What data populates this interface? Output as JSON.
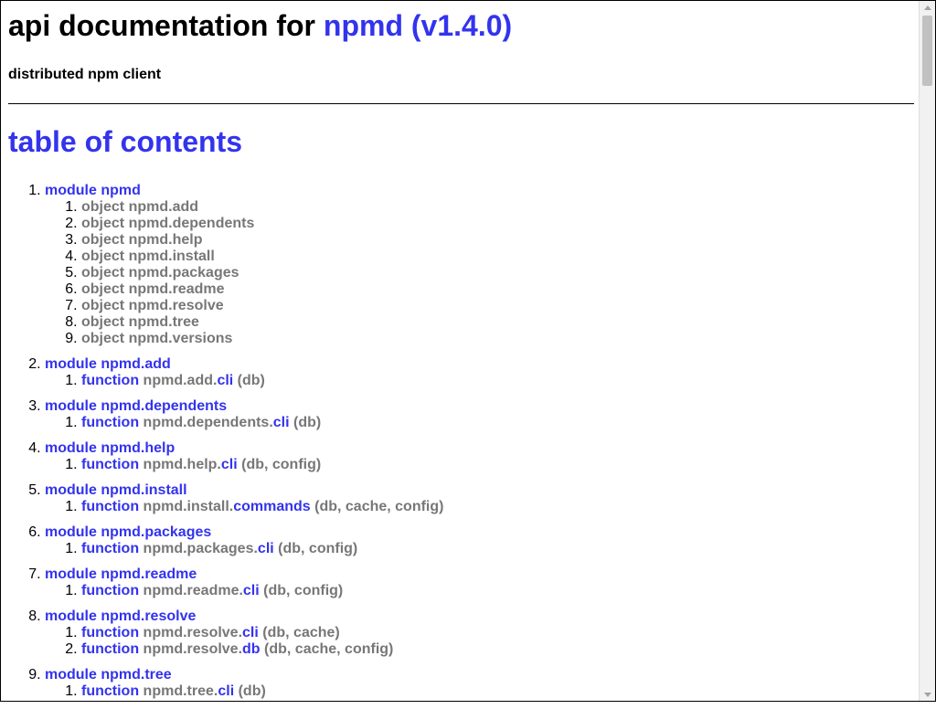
{
  "header": {
    "prefix": "api documentation for ",
    "link": "npmd (v1.4.0)",
    "subtitle": "distributed npm client"
  },
  "toc": {
    "title": "table of contents",
    "modules": [
      {
        "label": "module npmd",
        "items": [
          {
            "kind": "object",
            "name": "npmd.add"
          },
          {
            "kind": "object",
            "name": "npmd.dependents"
          },
          {
            "kind": "object",
            "name": "npmd.help"
          },
          {
            "kind": "object",
            "name": "npmd.install"
          },
          {
            "kind": "object",
            "name": "npmd.packages"
          },
          {
            "kind": "object",
            "name": "npmd.readme"
          },
          {
            "kind": "object",
            "name": "npmd.resolve"
          },
          {
            "kind": "object",
            "name": "npmd.tree"
          },
          {
            "kind": "object",
            "name": "npmd.versions"
          }
        ]
      },
      {
        "label": "module npmd.add",
        "items": [
          {
            "kind": "function",
            "prefix": "npmd.add.",
            "fn": "cli",
            "args": " (db)"
          }
        ]
      },
      {
        "label": "module npmd.dependents",
        "items": [
          {
            "kind": "function",
            "prefix": "npmd.dependents.",
            "fn": "cli",
            "args": " (db)"
          }
        ]
      },
      {
        "label": "module npmd.help",
        "items": [
          {
            "kind": "function",
            "prefix": "npmd.help.",
            "fn": "cli",
            "args": " (db, config)"
          }
        ]
      },
      {
        "label": "module npmd.install",
        "items": [
          {
            "kind": "function",
            "prefix": "npmd.install.",
            "fn": "commands",
            "args": " (db, cache, config)"
          }
        ]
      },
      {
        "label": "module npmd.packages",
        "items": [
          {
            "kind": "function",
            "prefix": "npmd.packages.",
            "fn": "cli",
            "args": " (db, config)"
          }
        ]
      },
      {
        "label": "module npmd.readme",
        "items": [
          {
            "kind": "function",
            "prefix": "npmd.readme.",
            "fn": "cli",
            "args": " (db, config)"
          }
        ]
      },
      {
        "label": "module npmd.resolve",
        "items": [
          {
            "kind": "function",
            "prefix": "npmd.resolve.",
            "fn": "cli",
            "args": " (db, cache)"
          },
          {
            "kind": "function",
            "prefix": "npmd.resolve.",
            "fn": "db",
            "args": " (db, cache, config)"
          }
        ]
      },
      {
        "label": "module npmd.tree",
        "items": [
          {
            "kind": "function",
            "prefix": "npmd.tree.",
            "fn": "cli",
            "args": " (db)"
          }
        ]
      }
    ]
  }
}
